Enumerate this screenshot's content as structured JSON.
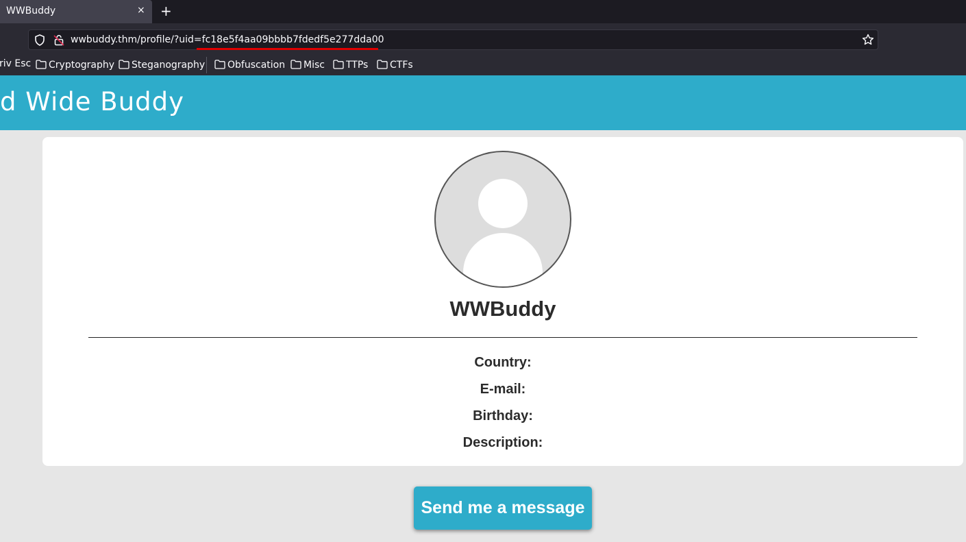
{
  "browser": {
    "tab_title": "WWBuddy",
    "tab_close": "×",
    "new_tab": "+",
    "url": "wwbuddy.thm/profile/?uid=fc18e5f4aa09bbbb7fdedf5e277dda00",
    "bookmarks": [
      "riv Esc",
      "Cryptography",
      "Steganography",
      "Obfuscation",
      "Misc",
      "TTPs",
      "CTFs"
    ],
    "icons": [
      "shield-icon",
      "lock-icon",
      "star-icon",
      "folder-icon"
    ]
  },
  "site": {
    "title": "d Wide Buddy"
  },
  "profile": {
    "username": "WWBuddy",
    "fields": {
      "country": "Country:",
      "email": "E-mail:",
      "birthday": "Birthday:",
      "description": "Description:"
    }
  },
  "actions": {
    "send_message": "Send me a message"
  },
  "colors": {
    "accent": "#2eacca",
    "annotation_underline": "#e00000"
  }
}
